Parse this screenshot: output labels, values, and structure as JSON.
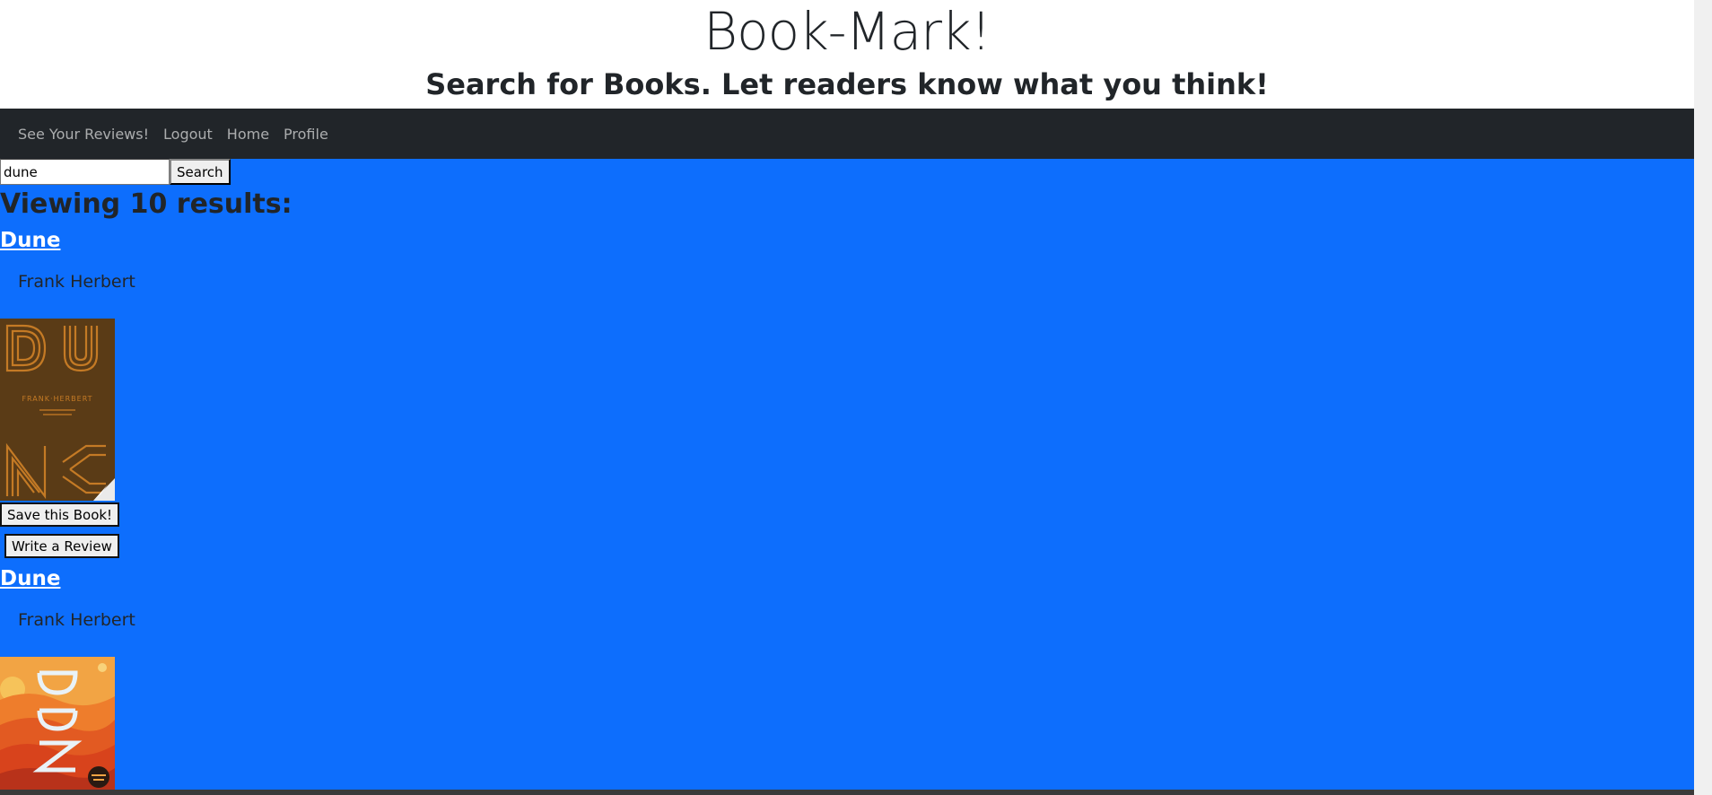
{
  "header": {
    "title": "Book-Mark!",
    "subtitle": "Search for Books. Let readers know what you think!"
  },
  "nav": {
    "items": [
      "See Your Reviews!",
      "Logout",
      "Home",
      "Profile"
    ]
  },
  "search": {
    "value": "dune",
    "button_label": "Search"
  },
  "results": {
    "heading": "Viewing 10 results:",
    "books": [
      {
        "title": "Dune",
        "author": "Frank Herbert",
        "save_label": "Save this Book!",
        "review_label": "Write a Review"
      },
      {
        "title": "Dune",
        "author": "Frank Herbert"
      }
    ]
  },
  "colors": {
    "main_background": "#0d6efd",
    "navbar": "#212529"
  }
}
